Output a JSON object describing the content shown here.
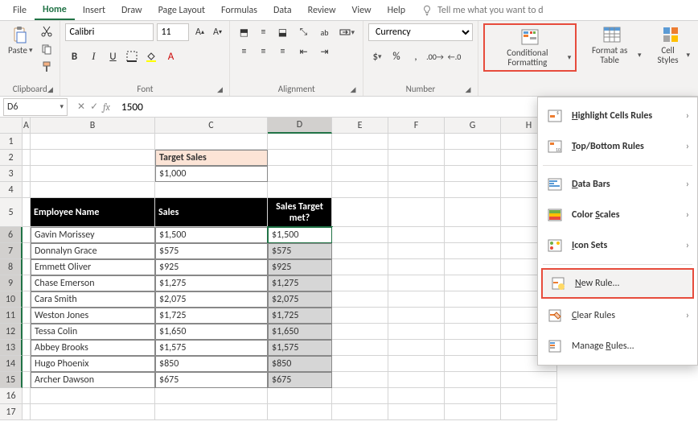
{
  "tabs": [
    "File",
    "Home",
    "Insert",
    "Draw",
    "Page Layout",
    "Formulas",
    "Data",
    "Review",
    "View",
    "Help"
  ],
  "active_tab": "Home",
  "tell_me": "Tell me what you want to d",
  "clipboard": {
    "paste": "Paste",
    "label": "Clipboard"
  },
  "font": {
    "name": "Calibri",
    "size": "11",
    "bold": "B",
    "italic": "I",
    "underline": "U",
    "label": "Font"
  },
  "alignment": {
    "label": "Alignment"
  },
  "number": {
    "format": "Currency",
    "label": "Number"
  },
  "styles": {
    "cond_fmt": "Conditional Formatting",
    "fmt_table": "Format as Table",
    "cell_styles": "Cell Styles"
  },
  "name_box": "D6",
  "formula_value": "1500",
  "columns": [
    "A",
    "B",
    "C",
    "D",
    "E",
    "F",
    "G",
    "H"
  ],
  "rows": [
    "1",
    "2",
    "3",
    "4",
    "5",
    "6",
    "7",
    "8",
    "9",
    "10",
    "11",
    "12",
    "13",
    "14",
    "15",
    "16",
    "17"
  ],
  "cells": {
    "C2": "Target Sales",
    "C3": "$1,000",
    "B5": "Employee Name",
    "C5": "Sales",
    "D5": "Sales Target met?",
    "employees": [
      {
        "name": "Gavin Morissey",
        "sales": "$1,500",
        "target": "$1,500"
      },
      {
        "name": "Donnalyn Grace",
        "sales": "$575",
        "target": "$575"
      },
      {
        "name": "Emmett Oliver",
        "sales": "$925",
        "target": "$925"
      },
      {
        "name": "Chase Emerson",
        "sales": "$1,275",
        "target": "$1,275"
      },
      {
        "name": "Cara Smith",
        "sales": "$2,075",
        "target": "$2,075"
      },
      {
        "name": "Weston Jones",
        "sales": "$1,725",
        "target": "$1,725"
      },
      {
        "name": "Tessa Colin",
        "sales": "$1,650",
        "target": "$1,650"
      },
      {
        "name": "Abbey Brooks",
        "sales": "$1,575",
        "target": "$1,575"
      },
      {
        "name": "Hugo Phoenix",
        "sales": "$850",
        "target": "$850"
      },
      {
        "name": "Archer Dawson",
        "sales": "$675",
        "target": "$675"
      }
    ]
  },
  "cf_menu": {
    "highlight": "Highlight Cells Rules",
    "topbottom": "Top/Bottom Rules",
    "databars": "Data Bars",
    "colorscales": "Color Scales",
    "iconsets": "Icon Sets",
    "newrule": "New Rule...",
    "clear": "Clear Rules",
    "manage": "Manage Rules..."
  }
}
